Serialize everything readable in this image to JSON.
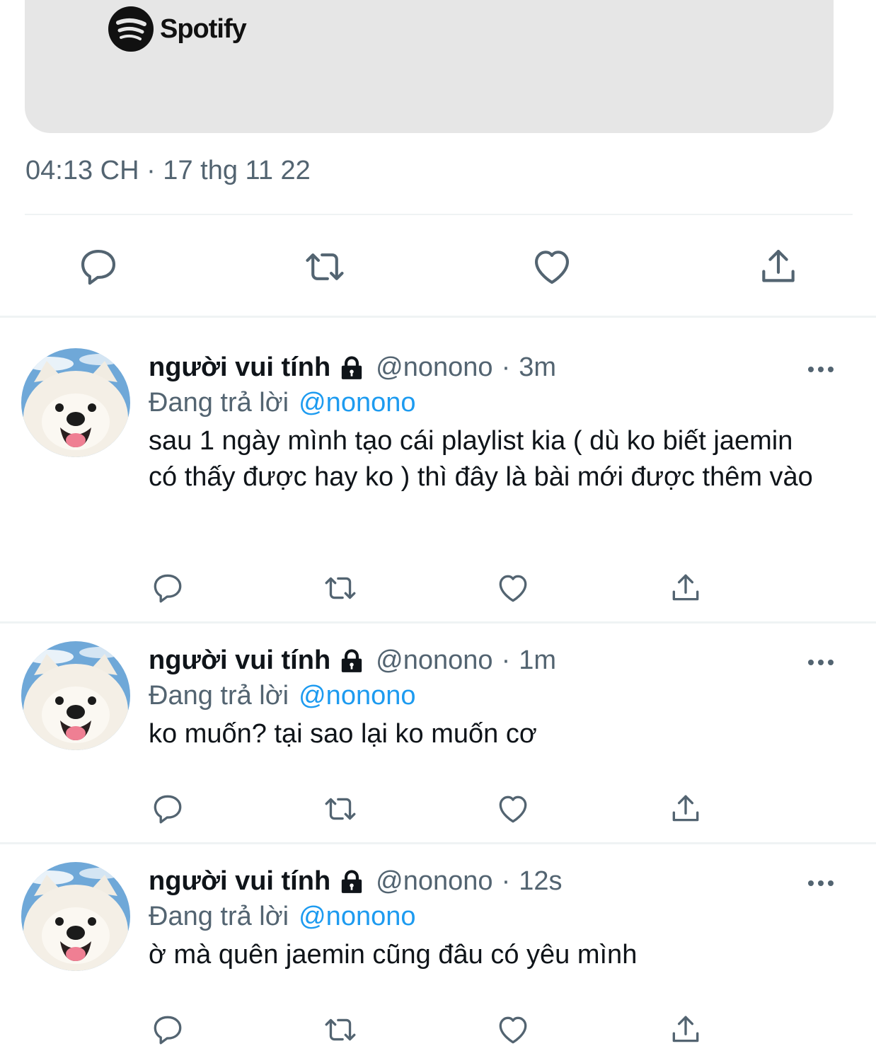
{
  "embed": {
    "brand_name": "Spotify",
    "brand_icon": "spotify-logo-icon"
  },
  "tweet": {
    "timestamp": "04:13 CH · 17 thg 11 22"
  },
  "actions": {
    "reply_icon": "reply-icon",
    "retweet_icon": "retweet-icon",
    "like_icon": "heart-icon",
    "share_icon": "share-icon"
  },
  "replies": [
    {
      "name": "người vui tính",
      "handle": "@nonono",
      "separator": "·",
      "time": "3m",
      "replying_label": "Đang trả lời",
      "replying_to": "@nonono",
      "text": "sau 1 ngày mình tạo cái playlist kia ( dù ko biết jaemin có thấy được hay ko ) thì đây là bài mới được thêm vào"
    },
    {
      "name": "người vui tính",
      "handle": "@nonono",
      "separator": "·",
      "time": "1m",
      "replying_label": "Đang trả lời",
      "replying_to": "@nonono",
      "text": "ko muốn? tại sao lại ko muốn cơ"
    },
    {
      "name": "người vui tính",
      "handle": "@nonono",
      "separator": "·",
      "time": "12s",
      "replying_label": "Đang trả lời",
      "replying_to": "@nonono",
      "text": "ờ mà quên jaemin cũng đâu có yêu mình"
    }
  ],
  "colors": {
    "link": "#1d9bf0",
    "muted": "#536471",
    "card_bg": "#e6e6e6",
    "icon": "#536471"
  }
}
